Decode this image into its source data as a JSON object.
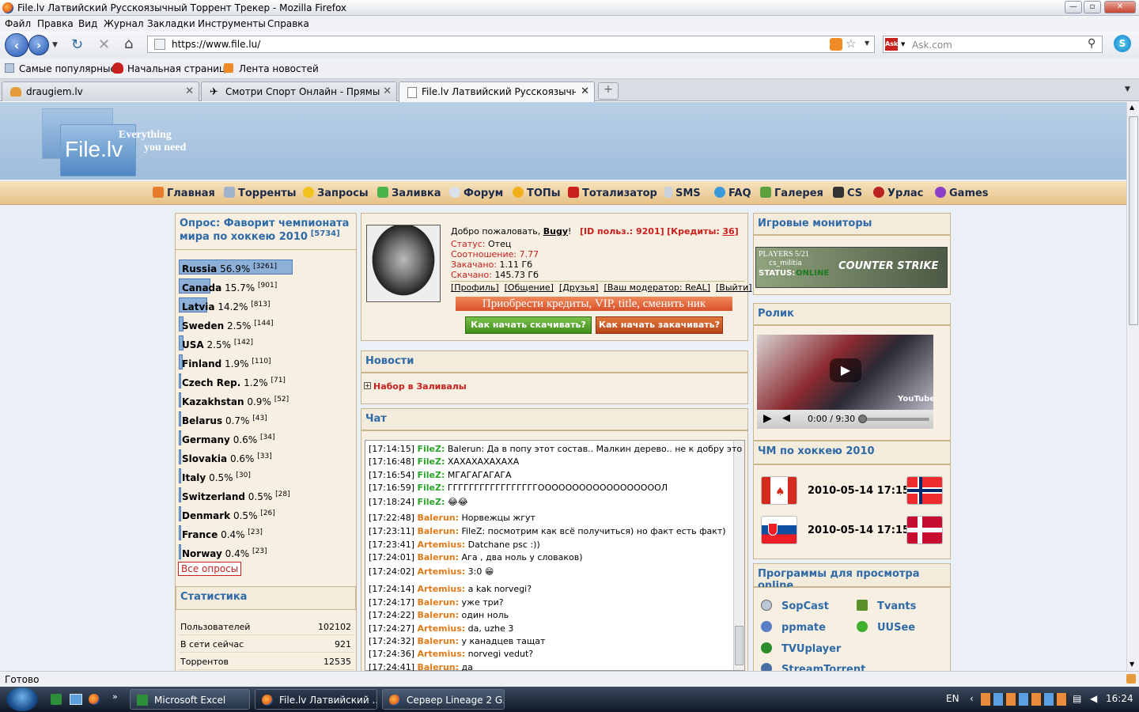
{
  "window": {
    "title": "File.lv Латвийский Русскоязычный Торрент Трекер - Mozilla Firefox",
    "min": "—",
    "max": "▫",
    "close": "✕"
  },
  "menubar": [
    "Файл",
    "Правка",
    "Вид",
    "Журнал",
    "Закладки",
    "Инструменты",
    "Справка"
  ],
  "nav": {
    "url": "https://www.file.lu/",
    "search_placeholder": "Ask.com",
    "search_brand": "Ask"
  },
  "bookmarks": [
    "Самые популярные",
    "Начальная страница",
    "Лента новостей"
  ],
  "tabs": [
    {
      "label": "draugiem.lv"
    },
    {
      "label": "Смотри Спорт Онлайн - Прямые ..."
    },
    {
      "label": "File.lv Латвийский Русскоязычн..."
    }
  ],
  "site": {
    "logo": "File.lv",
    "slogan1": "Everything",
    "slogan2": "you need",
    "menu": [
      "Главная",
      "Торренты",
      "Запросы",
      "Заливка",
      "Форум",
      "ТОПы",
      "Тотализатор",
      "SMS",
      "FAQ",
      "Галерея",
      "CS",
      "Урлас",
      "Games"
    ],
    "poll": {
      "title": "Опрос: Фаворит чемпионата мира по хоккею 2010",
      "total": "[5734]",
      "items": [
        {
          "name": "Russia",
          "pct": "56.9%",
          "count": "[3261]",
          "v": 56.9
        },
        {
          "name": "Canada",
          "pct": "15.7%",
          "count": "[901]",
          "v": 15.7
        },
        {
          "name": "Latvia",
          "pct": "14.2%",
          "count": "[813]",
          "v": 14.2
        },
        {
          "name": "Sweden",
          "pct": "2.5%",
          "count": "[144]",
          "v": 2.5
        },
        {
          "name": "USA",
          "pct": "2.5%",
          "count": "[142]",
          "v": 2.5
        },
        {
          "name": "Finland",
          "pct": "1.9%",
          "count": "[110]",
          "v": 1.9
        },
        {
          "name": "Czech Rep.",
          "pct": "1.2%",
          "count": "[71]",
          "v": 1.2
        },
        {
          "name": "Kazakhstan",
          "pct": "0.9%",
          "count": "[52]",
          "v": 0.9
        },
        {
          "name": "Belarus",
          "pct": "0.7%",
          "count": "[43]",
          "v": 0.7
        },
        {
          "name": "Germany",
          "pct": "0.6%",
          "count": "[34]",
          "v": 0.6
        },
        {
          "name": "Slovakia",
          "pct": "0.6%",
          "count": "[33]",
          "v": 0.6
        },
        {
          "name": "Italy",
          "pct": "0.5%",
          "count": "[30]",
          "v": 0.5
        },
        {
          "name": "Switzerland",
          "pct": "0.5%",
          "count": "[28]",
          "v": 0.5
        },
        {
          "name": "Denmark",
          "pct": "0.5%",
          "count": "[26]",
          "v": 0.5
        },
        {
          "name": "France",
          "pct": "0.4%",
          "count": "[23]",
          "v": 0.4
        },
        {
          "name": "Norway",
          "pct": "0.4%",
          "count": "[23]",
          "v": 0.4
        }
      ],
      "all_link": "Все опросы"
    },
    "stats": {
      "title": "Статистика",
      "rows": [
        {
          "label": "Пользователей",
          "value": "102102"
        },
        {
          "label": "В сети сейчас",
          "value": "921"
        },
        {
          "label": "Торрентов",
          "value": "12535"
        }
      ]
    },
    "user": {
      "welcome": "Добро пожаловать,",
      "name": "Bugy",
      "exclam": "!",
      "id_label": "[ID польз.: 9201]",
      "credits_label": "[Кредиты:",
      "credits": "36",
      "credits_end": "]",
      "status_label": "Статус:",
      "status": "Отец",
      "ratio_label": "Соотношение:",
      "ratio": "7.77",
      "up_label": "Закачано:",
      "up": "1.11 Гб",
      "down_label": "Скачано:",
      "down": "145.73 Гб",
      "links": [
        "[Профиль]",
        "[Общение]",
        "[Друзья]",
        "[Ваш модератор: ReAL]",
        "[Выйти]"
      ],
      "banner": "Приобрести кредиты, VIP, title, сменить ник",
      "btn_download": "Как начать скачивать?",
      "btn_upload": "Как начать закачивать?"
    },
    "news": {
      "title": "Новости",
      "item": "Набор в Заливалы"
    },
    "chat": {
      "title": "Чат",
      "lines": [
        {
          "t": "[17:14:15]",
          "n": "FileZ:",
          "g": true,
          "m": "Balerun: Да в попу этот состав.. Малкин дерево.. не к добру это"
        },
        {
          "t": "[17:16:48]",
          "n": "FileZ:",
          "g": true,
          "m": "ХАХАХАХАХАХА"
        },
        {
          "t": "[17:16:54]",
          "n": "FileZ:",
          "g": true,
          "m": "МГАГАГАГАГА"
        },
        {
          "t": "[17:16:59]",
          "n": "FileZ:",
          "g": true,
          "m": "ГГГГГГГГГГГГГГГГГООООООООООООООООООЛ"
        },
        {
          "t": "[17:18:24]",
          "n": "FileZ:",
          "g": true,
          "m": "😂😂"
        },
        {
          "t": "[17:22:48]",
          "n": "Balerun:",
          "g": false,
          "m": "Норвежцы жгут"
        },
        {
          "t": "[17:23:11]",
          "n": "Balerun:",
          "g": false,
          "m": "FileZ: посмотрим как всё получиться) но факт есть факт)"
        },
        {
          "t": "[17:23:41]",
          "n": "Artemius:",
          "g": false,
          "m": "Datchane psc :))"
        },
        {
          "t": "[17:24:01]",
          "n": "Balerun:",
          "g": false,
          "m": "Ага , два ноль у словаков)"
        },
        {
          "t": "[17:24:02]",
          "n": "Artemius:",
          "g": false,
          "m": "3:0 😁"
        },
        {
          "t": "[17:24:14]",
          "n": "Artemius:",
          "g": false,
          "m": "a kak norvegi?"
        },
        {
          "t": "[17:24:17]",
          "n": "Balerun:",
          "g": false,
          "m": "уже три?"
        },
        {
          "t": "[17:24:22]",
          "n": "Balerun:",
          "g": false,
          "m": "один ноль"
        },
        {
          "t": "[17:24:27]",
          "n": "Artemius:",
          "g": false,
          "m": "da, uzhe 3"
        },
        {
          "t": "[17:24:32]",
          "n": "Balerun:",
          "g": false,
          "m": "у канадцев тащат"
        },
        {
          "t": "[17:24:36]",
          "n": "Artemius:",
          "g": false,
          "m": "norvegi vedut?"
        },
        {
          "t": "[17:24:41]",
          "n": "Balerun:",
          "g": false,
          "m": "да"
        }
      ]
    },
    "monitors": {
      "title": "Игровые мониторы",
      "players": "PLAYERS 5/21",
      "map": "cs_militia",
      "status_label": "STATUS:",
      "status": "ONLINE",
      "game": "COUNTER STRIKE"
    },
    "video": {
      "title": "Ролик",
      "time": "0:00 / 9:30",
      "brand": "YouTube"
    },
    "hockey": {
      "title": "ЧМ по хоккею 2010",
      "matches": [
        {
          "date": "2010-05-14 17:15",
          "home": "canada",
          "away": "norway"
        },
        {
          "date": "2010-05-14 17:15",
          "home": "slovakia",
          "away": "denmark"
        }
      ]
    },
    "programs": {
      "title": "Программы для просмотра online",
      "items": [
        "SopCast",
        "Tvants",
        "ppmate",
        "UUSee",
        "TVUplayer",
        "StreamTorrent"
      ]
    }
  },
  "status": "Готово",
  "taskbar": {
    "items": [
      "Microsoft Excel",
      "File.lv Латвийский ...",
      "Сервер Lineage 2 G..."
    ],
    "lang": "EN",
    "time": "16:24"
  },
  "colors": {
    "accent": "#2e6aa7",
    "orange_nick": "#e07b1a",
    "green_nick": "#29a329",
    "red": "#c8201d"
  }
}
